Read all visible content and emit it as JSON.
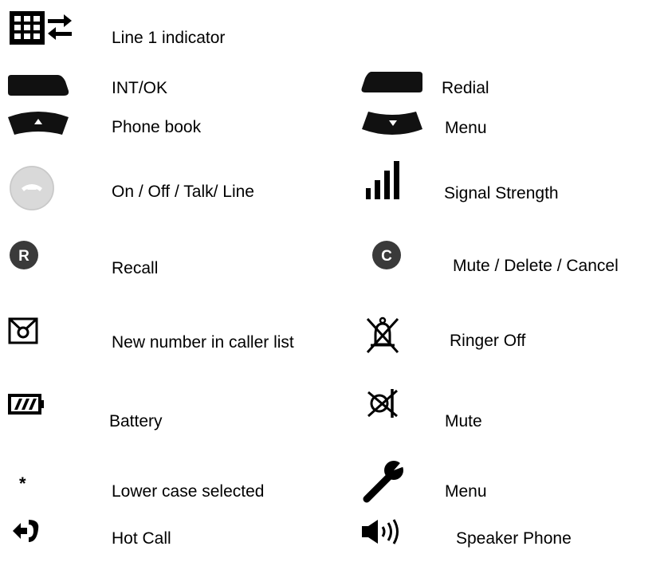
{
  "legend": {
    "line1_indicator": "Line 1 indicator",
    "int_ok": "INT/OK",
    "redial": "Redial",
    "phone_book": "Phone book",
    "menu_nav": "Menu",
    "talk": "On / Off / Talk/ Line",
    "signal": "Signal Strength",
    "recall": "Recall",
    "mute_delete": "Mute / Delete / Cancel",
    "new_number": "New number in caller list",
    "ringer_off": "Ringer Off",
    "battery": "Battery",
    "mute": "Mute",
    "lower_case": "Lower case selected",
    "menu_tool": "Menu",
    "hot_call": "Hot Call",
    "speaker": "Speaker Phone"
  },
  "icons": {
    "recall_letter": "R",
    "cancel_letter": "C",
    "asterisk": "*"
  }
}
